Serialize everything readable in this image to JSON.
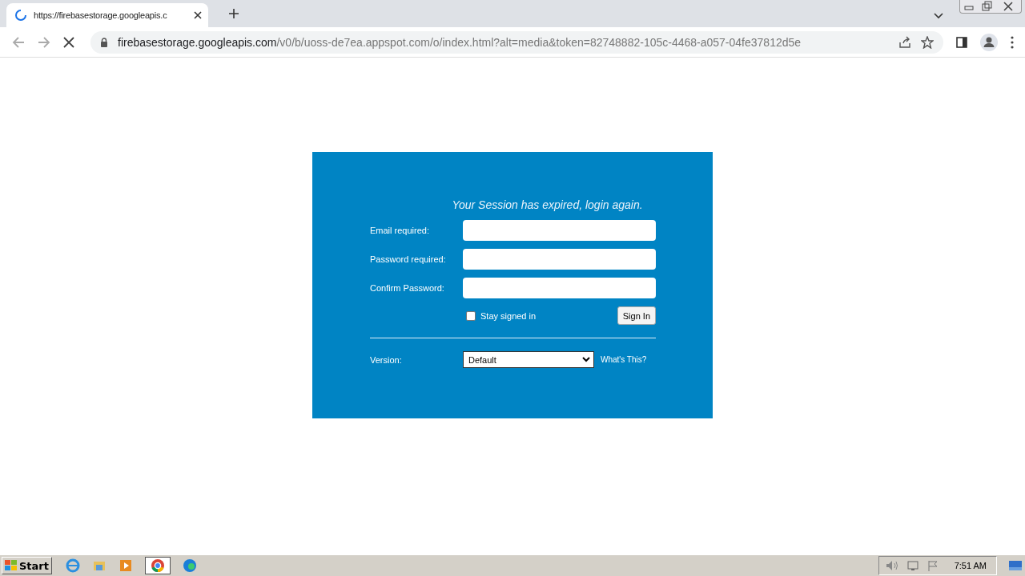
{
  "browser": {
    "tab": {
      "title": "https://firebasestorage.googleapis.c",
      "loading": true
    },
    "url": {
      "host": "firebasestorage.googleapis.com",
      "path": "/v0/b/uoss-de7ea.appspot.com/o/index.html?alt=media&token=82748882-105c-4468-a057-04fe37812d5e"
    }
  },
  "form": {
    "heading": "Your Session has expired, login again.",
    "fields": [
      {
        "label": "Email required:"
      },
      {
        "label": "Password required:"
      },
      {
        "label": "Confirm Password:"
      }
    ],
    "stay_signed_in": {
      "label": "Stay signed in",
      "checked": false
    },
    "submit": "Sign In",
    "version": {
      "label": "Version:",
      "value": "Default",
      "help": "What's This?"
    }
  },
  "taskbar": {
    "start": "Start",
    "clock": "7:51 AM"
  }
}
